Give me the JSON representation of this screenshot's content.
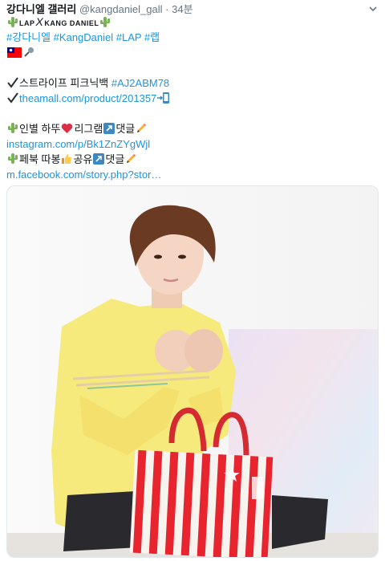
{
  "tweet": {
    "display_name": "강다니엘 갤러리",
    "handle": "@kangdaniel_gall",
    "separator": "·",
    "timestamp": "34분",
    "brand_left": "LAP",
    "brand_x": "X",
    "brand_right": "KANG DANIEL",
    "hashtags": "#강다니엘 #KangDaniel #LAP #랩",
    "product_name": "스트라이프 피크닉백",
    "product_code": "#AJ2ABM78",
    "product_url": "theamall.com/product/201357",
    "instagram_text": "인별 하뚜",
    "instagram_text2": "리그램",
    "instagram_text3": "댓글",
    "instagram_url": "instagram.com/p/Bk1ZnZYgWjl",
    "facebook_text": "페북 따봉",
    "facebook_text2": "공유",
    "facebook_text3": "댓글",
    "facebook_url": "m.facebook.com/story.php?stor…"
  },
  "icons": [
    "cactus-icon",
    "taiwan-flag-icon",
    "microphone-icon",
    "checkmark-icon",
    "phone-icon",
    "heart-icon",
    "share-arrow-icon",
    "pencil-icon",
    "thumbs-up-icon",
    "chevron-down-icon"
  ],
  "colors": {
    "link": "#1b95e0",
    "muted": "#657786",
    "text": "#14171a"
  }
}
